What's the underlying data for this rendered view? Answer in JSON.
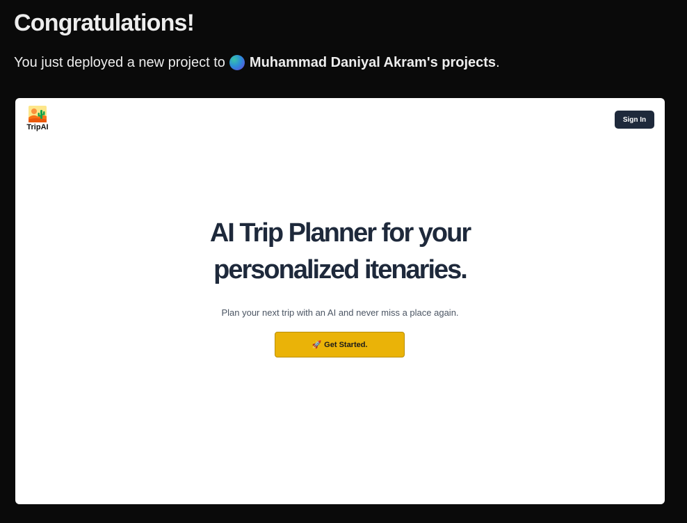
{
  "header": {
    "title": "Congratulations!",
    "message_prefix": "You just deployed a new project to",
    "team_name": "Muhammad Daniyal Akram's projects",
    "message_suffix": "."
  },
  "preview": {
    "brand": "TripAI",
    "signin_label": "Sign In",
    "hero_line1": "AI Trip Planner for your",
    "hero_line2": "personalized itenaries.",
    "hero_subtitle": "Plan your next trip with an AI and never miss a place again.",
    "cta_icon": "🚀",
    "cta_label": "Get Started."
  },
  "colors": {
    "page_background": "#0a0a0a",
    "preview_background": "#ffffff",
    "signin_background": "#1e293b",
    "cta_background": "#eab308",
    "hero_text": "#1e293b"
  },
  "icons": {
    "team_avatar": "gradient-circle-avatar",
    "logo": "desert-cactus-logo-icon",
    "cta": "rocket-icon"
  }
}
